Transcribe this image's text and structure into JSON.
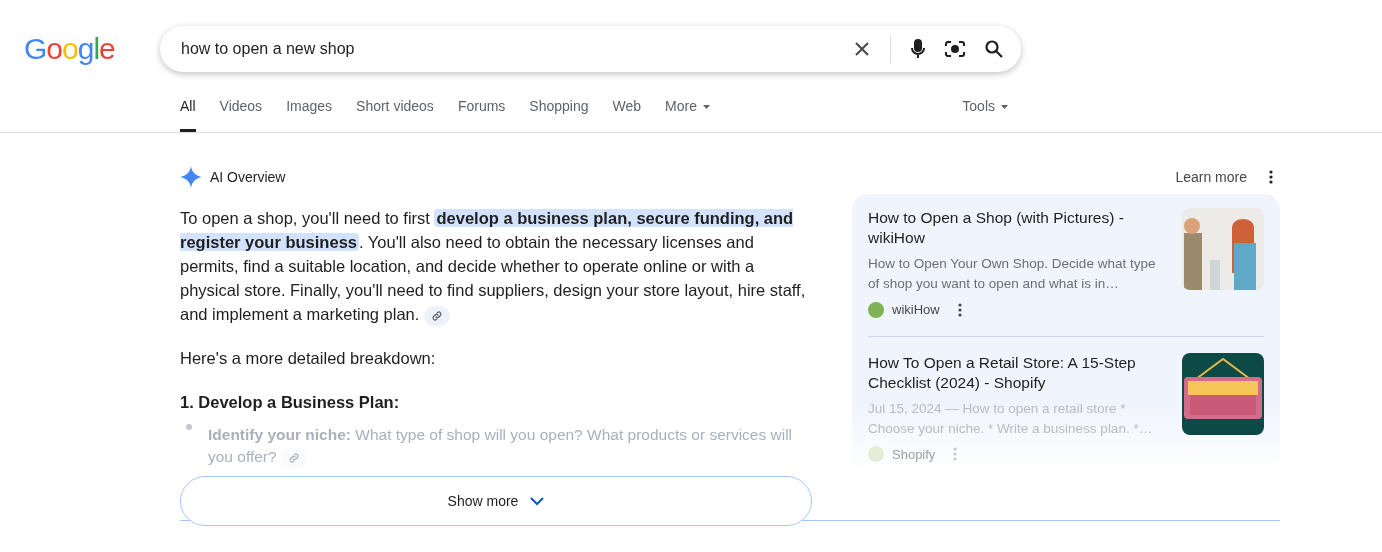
{
  "logo": "Google",
  "search": {
    "value": "how to open a new shop"
  },
  "tabs": [
    {
      "label": "All",
      "selected": true
    },
    {
      "label": "Videos",
      "selected": false
    },
    {
      "label": "Images",
      "selected": false
    },
    {
      "label": "Short videos",
      "selected": false
    },
    {
      "label": "Forums",
      "selected": false
    },
    {
      "label": "Shopping",
      "selected": false
    },
    {
      "label": "Web",
      "selected": false
    },
    {
      "label": "More",
      "selected": false
    }
  ],
  "tools": "Tools",
  "ai_overview": {
    "title": "AI Overview",
    "learn_more": "Learn more",
    "summary": "To open a shop, you'll need to first **develop a business plan, secure funding, and register your business**. You'll also need to obtain the necessary licenses and permits, find a suitable location, and decide whether to operate online or with a physical store. Finally, you'll need to find suppliers, design your store layout, hire staff, and implement a marketing plan.",
    "intro": "Here's a more detailed breakdown:",
    "heading": "1. Develop a Business Plan:",
    "bullets": [
      "**Identify your niche:** What type of shop will you open? What products or services will you offer?"
    ],
    "show_more": "Show more"
  },
  "sources": [
    {
      "title": "How to Open a Shop (with Pictures) - wikiHow",
      "snippet": "How to Open Your Own Shop. Decide what type of shop you want to open and what is in…",
      "site": "wikiHow"
    },
    {
      "title": "How To Open a Retail Store: A 15-Step Checklist (2024) - Shopify",
      "snippet": "Jul 15, 2024 — How to open a retail store * Choose your niche. * Write a business plan. *…",
      "site": "Shopify"
    }
  ]
}
